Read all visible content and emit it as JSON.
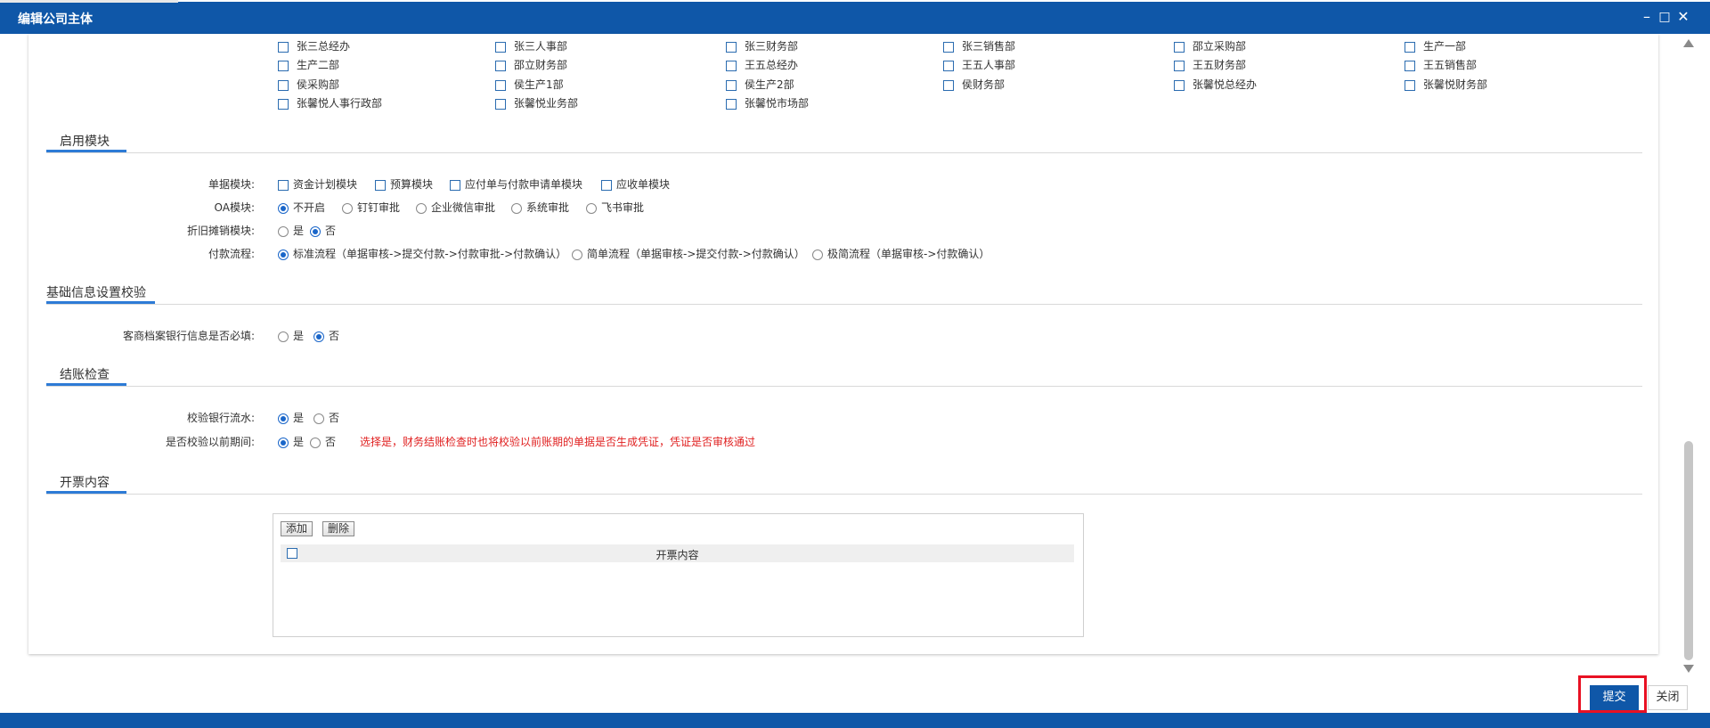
{
  "window": {
    "title": "编辑公司主体",
    "minimize_glyph": "–",
    "maximize_glyph": "□",
    "close_glyph": "✕"
  },
  "departments": [
    "张三总经办",
    "张三人事部",
    "张三财务部",
    "张三销售部",
    "邵立采购部",
    "生产一部",
    "生产二部",
    "邵立财务部",
    "王五总经办",
    "王五人事部",
    "王五财务部",
    "王五销售部",
    "侯采购部",
    "侯生产1部",
    "侯生产2部",
    "侯财务部",
    "张馨悦总经办",
    "张馨悦财务部",
    "张馨悦人事行政部",
    "张馨悦业务部",
    "张馨悦市场部"
  ],
  "sections": {
    "modules": "启用模块",
    "basic_check": "基础信息设置校验",
    "closing": "结账检查",
    "invoice": "开票内容"
  },
  "modules": {
    "doc_label": "单据模块:",
    "doc_options": [
      "资金计划模块",
      "预算模块",
      "应付单与付款申请单模块",
      "应收单模块"
    ],
    "oa_label": "OA模块:",
    "oa_options": [
      "不开启",
      "钉钉审批",
      "企业微信审批",
      "系统审批",
      "飞书审批"
    ],
    "oa_selected": "不开启",
    "depr_label": "折旧摊销模块:",
    "depr_options": [
      "是",
      "否"
    ],
    "depr_selected": "否",
    "pay_label": "付款流程:",
    "pay_options": [
      "标准流程（单据审核->提交付款->付款审批->付款确认）",
      "简单流程（单据审核->提交付款->付款确认）",
      "极简流程（单据审核->付款确认）"
    ],
    "pay_selected": "标准流程（单据审核->提交付款->付款审批->付款确认）"
  },
  "basic_check": {
    "bank_label": "客商档案银行信息是否必填:",
    "options": [
      "是",
      "否"
    ],
    "selected": "否"
  },
  "closing": {
    "bank_flow_label": "校验银行流水:",
    "bank_flow_options": [
      "是",
      "否"
    ],
    "bank_flow_selected": "是",
    "prior_label": "是否校验以前期间:",
    "prior_options": [
      "是",
      "否"
    ],
    "prior_selected": "是",
    "warning": "选择是，财务结账检查时也将校验以前账期的单据是否生成凭证，凭证是否审核通过"
  },
  "invoice": {
    "add_label": "添加",
    "delete_label": "删除",
    "column_header": "开票内容"
  },
  "footer": {
    "submit_label": "提交",
    "close_label": "关闭"
  },
  "colors": {
    "brand": "#0f57a8",
    "accent": "#2d7bd6",
    "warning": "#e02020",
    "highlight_border": "#e81123"
  }
}
